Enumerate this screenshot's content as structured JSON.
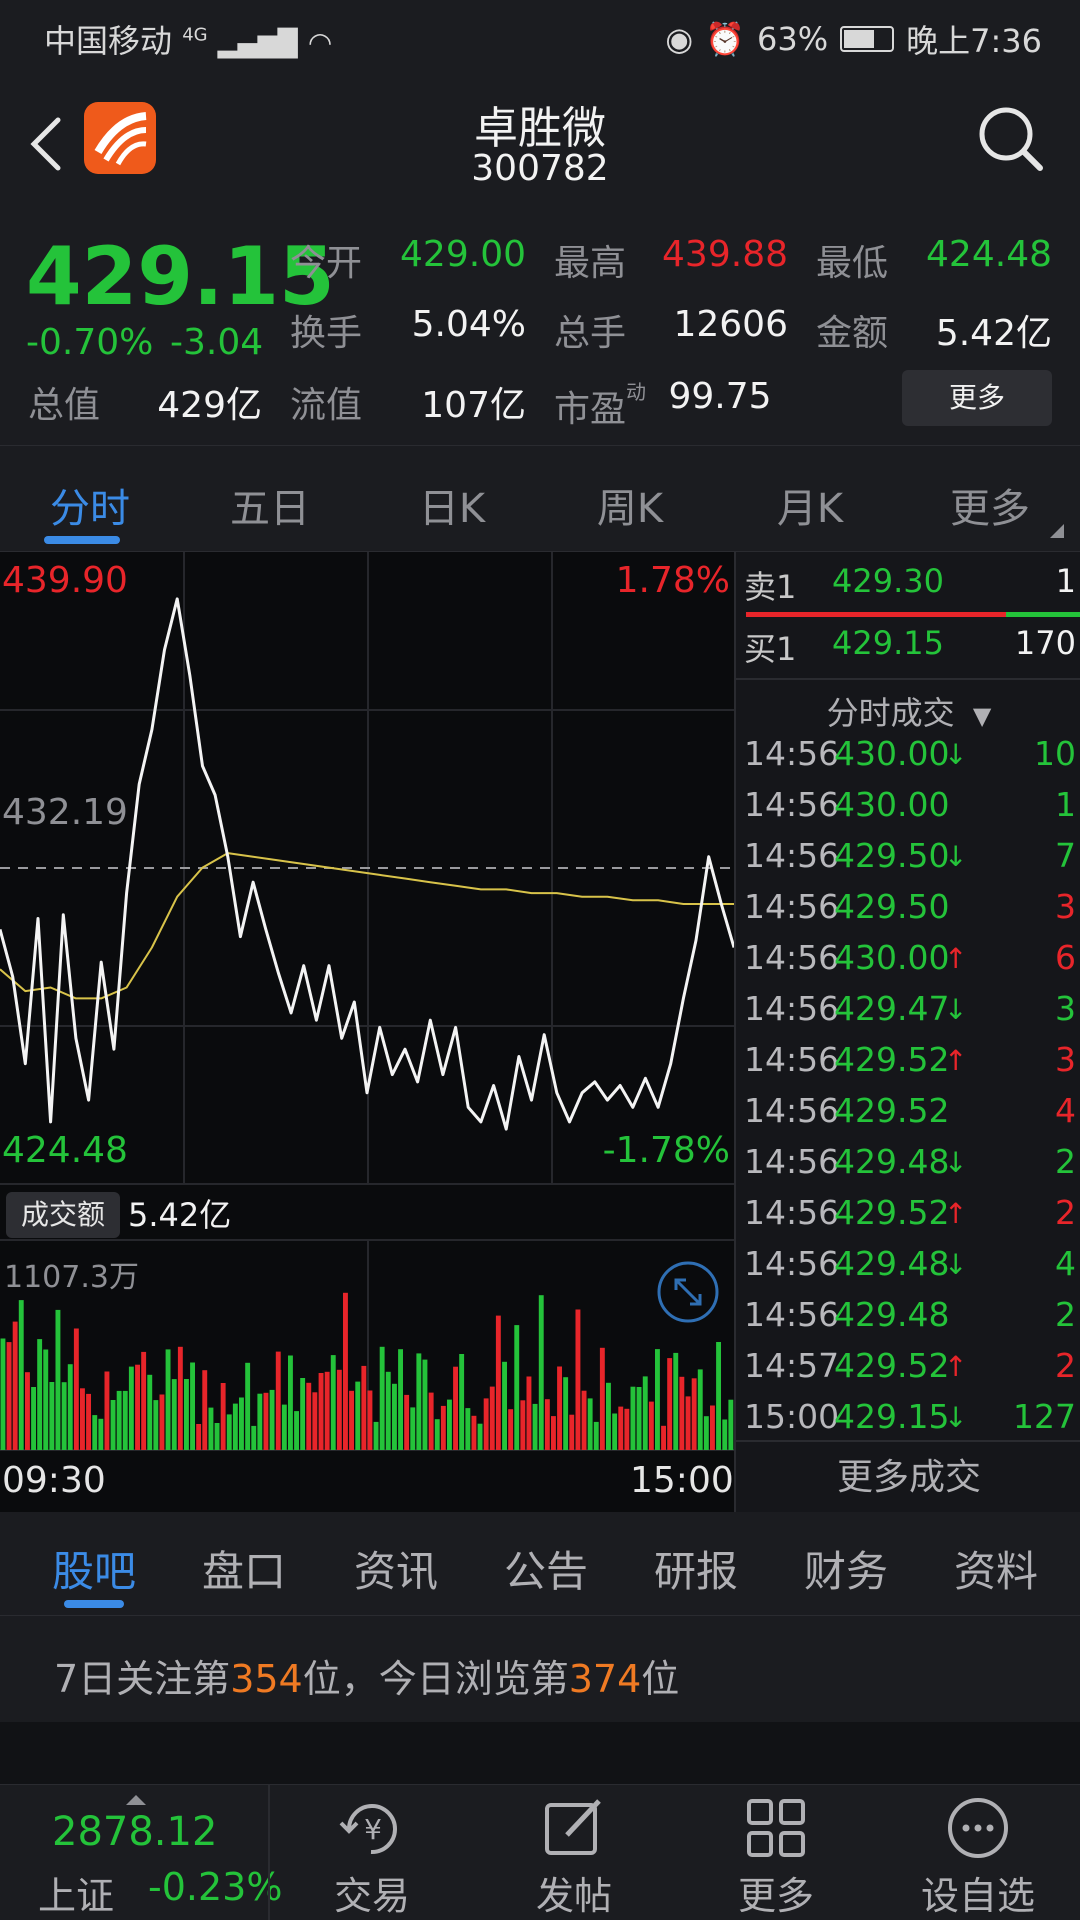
{
  "status_bar": {
    "carrier": "中国移动",
    "network": "4G",
    "battery": "63%",
    "time": "晚上7:36"
  },
  "header": {
    "name": "卓胜微",
    "code": "300782"
  },
  "quote": {
    "price": "429.15",
    "change_pct": "-0.70%",
    "change_val": "-3.04",
    "fields": [
      {
        "label": "今开",
        "value": "429.00",
        "color": "green"
      },
      {
        "label": "最高",
        "value": "439.88",
        "color": "red"
      },
      {
        "label": "最低",
        "value": "424.48",
        "color": "green"
      },
      {
        "label": "换手",
        "value": "5.04%",
        "color": "white"
      },
      {
        "label": "总手",
        "value": "12606",
        "color": "white"
      },
      {
        "label": "金额",
        "value": "5.42亿",
        "color": "white"
      },
      {
        "label": "总值",
        "value": "429亿",
        "color": "white"
      },
      {
        "label": "流值",
        "value": "107亿",
        "color": "white"
      },
      {
        "label": "市盈",
        "value": "99.75",
        "color": "white",
        "sup": "动"
      }
    ],
    "more_label": "更多"
  },
  "period_tabs": [
    "分时",
    "五日",
    "日K",
    "周K",
    "月K",
    "更多"
  ],
  "chart": {
    "price_high": "439.90",
    "price_low": "424.48",
    "price_mid": "432.19",
    "pct_high": "1.78%",
    "pct_low": "-1.78%",
    "turnover_label": "成交额",
    "turnover_value": "5.42亿",
    "volume_max": "1107.3万",
    "time_start": "09:30",
    "time_end": "15:00"
  },
  "chart_data": {
    "type": "line",
    "ylim": [
      424.48,
      439.9
    ],
    "series": [
      {
        "values": [
          430.5,
          429.2,
          426.8,
          430.8,
          425.2,
          430.9,
          427.5,
          425.8,
          429.6,
          427.2,
          431.5,
          434.5,
          436.0,
          438.2,
          439.6,
          437.5,
          435.0,
          434.2,
          432.5,
          430.3,
          431.8,
          430.5,
          429.3,
          428.2,
          429.5,
          428.0,
          429.5,
          427.5,
          428.5,
          426.0,
          427.8,
          426.5,
          427.2,
          426.3,
          428.0,
          426.5,
          427.8,
          425.6,
          425.2,
          426.2,
          425.0,
          427.0,
          425.8,
          427.6,
          426.0,
          425.2,
          426.0,
          426.3,
          425.8,
          426.2,
          425.6,
          426.4,
          425.6,
          426.8,
          428.6,
          430.2,
          432.5,
          431.2,
          430.0
        ]
      },
      {
        "values": [
          429.4,
          428.8,
          428.9,
          428.6,
          428.6,
          428.9,
          430.0,
          431.4,
          432.2,
          432.6,
          432.5,
          432.4,
          432.3,
          432.2,
          432.1,
          432.0,
          431.9,
          431.8,
          431.7,
          431.6,
          431.6,
          431.5,
          431.5,
          431.4,
          431.4,
          431.3,
          431.3,
          431.2,
          431.2,
          431.2
        ]
      }
    ]
  },
  "orderbook": {
    "sell1": {
      "label": "卖1",
      "price": "429.30",
      "qty": "1"
    },
    "buy1": {
      "label": "买1",
      "price": "429.15",
      "qty": "170"
    },
    "tick_header": "分时成交",
    "ticks": [
      {
        "time": "14:56",
        "price": "430.00",
        "dir": "down",
        "vol": "10",
        "vcolor": "green"
      },
      {
        "time": "14:56",
        "price": "430.00",
        "dir": "",
        "vol": "1",
        "vcolor": "green"
      },
      {
        "time": "14:56",
        "price": "429.50",
        "dir": "down",
        "vol": "7",
        "vcolor": "green"
      },
      {
        "time": "14:56",
        "price": "429.50",
        "dir": "",
        "vol": "3",
        "vcolor": "red"
      },
      {
        "time": "14:56",
        "price": "430.00",
        "dir": "up",
        "vol": "6",
        "vcolor": "red"
      },
      {
        "time": "14:56",
        "price": "429.47",
        "dir": "down",
        "vol": "3",
        "vcolor": "green"
      },
      {
        "time": "14:56",
        "price": "429.52",
        "dir": "up",
        "vol": "3",
        "vcolor": "red"
      },
      {
        "time": "14:56",
        "price": "429.52",
        "dir": "",
        "vol": "4",
        "vcolor": "red"
      },
      {
        "time": "14:56",
        "price": "429.48",
        "dir": "down",
        "vol": "2",
        "vcolor": "green"
      },
      {
        "time": "14:56",
        "price": "429.52",
        "dir": "up",
        "vol": "2",
        "vcolor": "red"
      },
      {
        "time": "14:56",
        "price": "429.48",
        "dir": "down",
        "vol": "4",
        "vcolor": "green"
      },
      {
        "time": "14:56",
        "price": "429.48",
        "dir": "",
        "vol": "2",
        "vcolor": "green"
      },
      {
        "time": "14:57",
        "price": "429.52",
        "dir": "up",
        "vol": "2",
        "vcolor": "red"
      },
      {
        "time": "15:00",
        "price": "429.15",
        "dir": "down",
        "vol": "127",
        "vcolor": "green"
      }
    ],
    "more_label": "更多成交"
  },
  "info_tabs": [
    "股吧",
    "盘口",
    "资讯",
    "公告",
    "研报",
    "财务",
    "资料"
  ],
  "rank": {
    "p1": "7日关注第",
    "n1": "354",
    "p2": "位，今日浏览第",
    "n2": "374",
    "p3": "位"
  },
  "bottom_nav": {
    "index_value": "2878.12",
    "index_name": "上证",
    "index_change": "-0.23%",
    "items": [
      {
        "label": "交易",
        "icon": "yen-refresh-icon"
      },
      {
        "label": "发帖",
        "icon": "edit-icon"
      },
      {
        "label": "更多",
        "icon": "grid-icon"
      },
      {
        "label": "设自选",
        "icon": "dots-circle-icon"
      }
    ]
  },
  "colors": {
    "up": "#e8252a",
    "down": "#24c33a",
    "accent": "#3b8be6",
    "avg_line": "#d8c34a",
    "highlight": "#ef7a23"
  }
}
